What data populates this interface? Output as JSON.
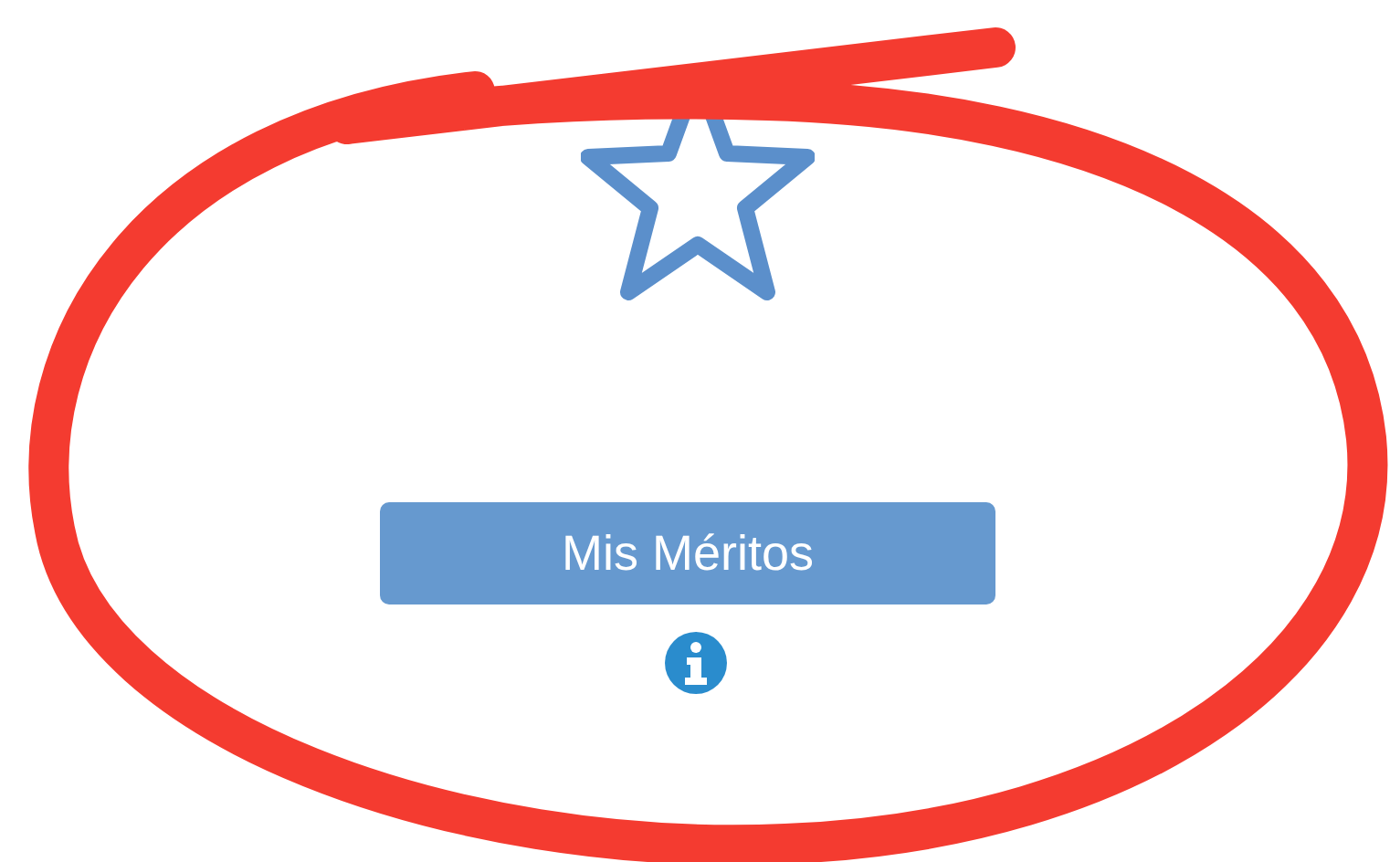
{
  "merits": {
    "button": {
      "label": "Mis Méritos"
    }
  }
}
